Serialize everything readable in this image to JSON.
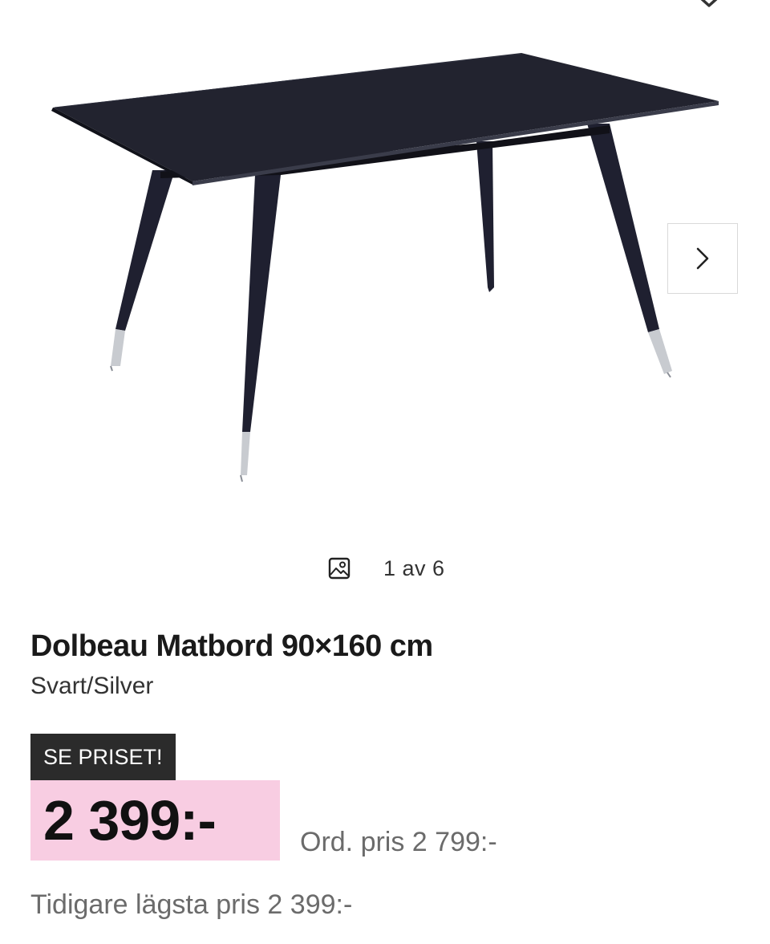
{
  "product": {
    "title": "Dolbeau Matbord 90×160 cm",
    "variant": "Svart/Silver"
  },
  "gallery": {
    "counter_text": "1 av 6",
    "current": 1,
    "total": 6,
    "image_icon": "image-icon",
    "next_icon": "chevron-right-icon",
    "top_icon": "chevron-down-icon"
  },
  "pricing": {
    "badge": "SE PRISET!",
    "price": "2 399:-",
    "ordinary_price": "Ord. pris 2 799:-",
    "lowest_price": "Tidigare lägsta pris 2 399:-"
  },
  "colors": {
    "price_highlight": "#f8cde2",
    "badge_background": "#2b2b2b",
    "muted_text": "#6b6b6b"
  }
}
